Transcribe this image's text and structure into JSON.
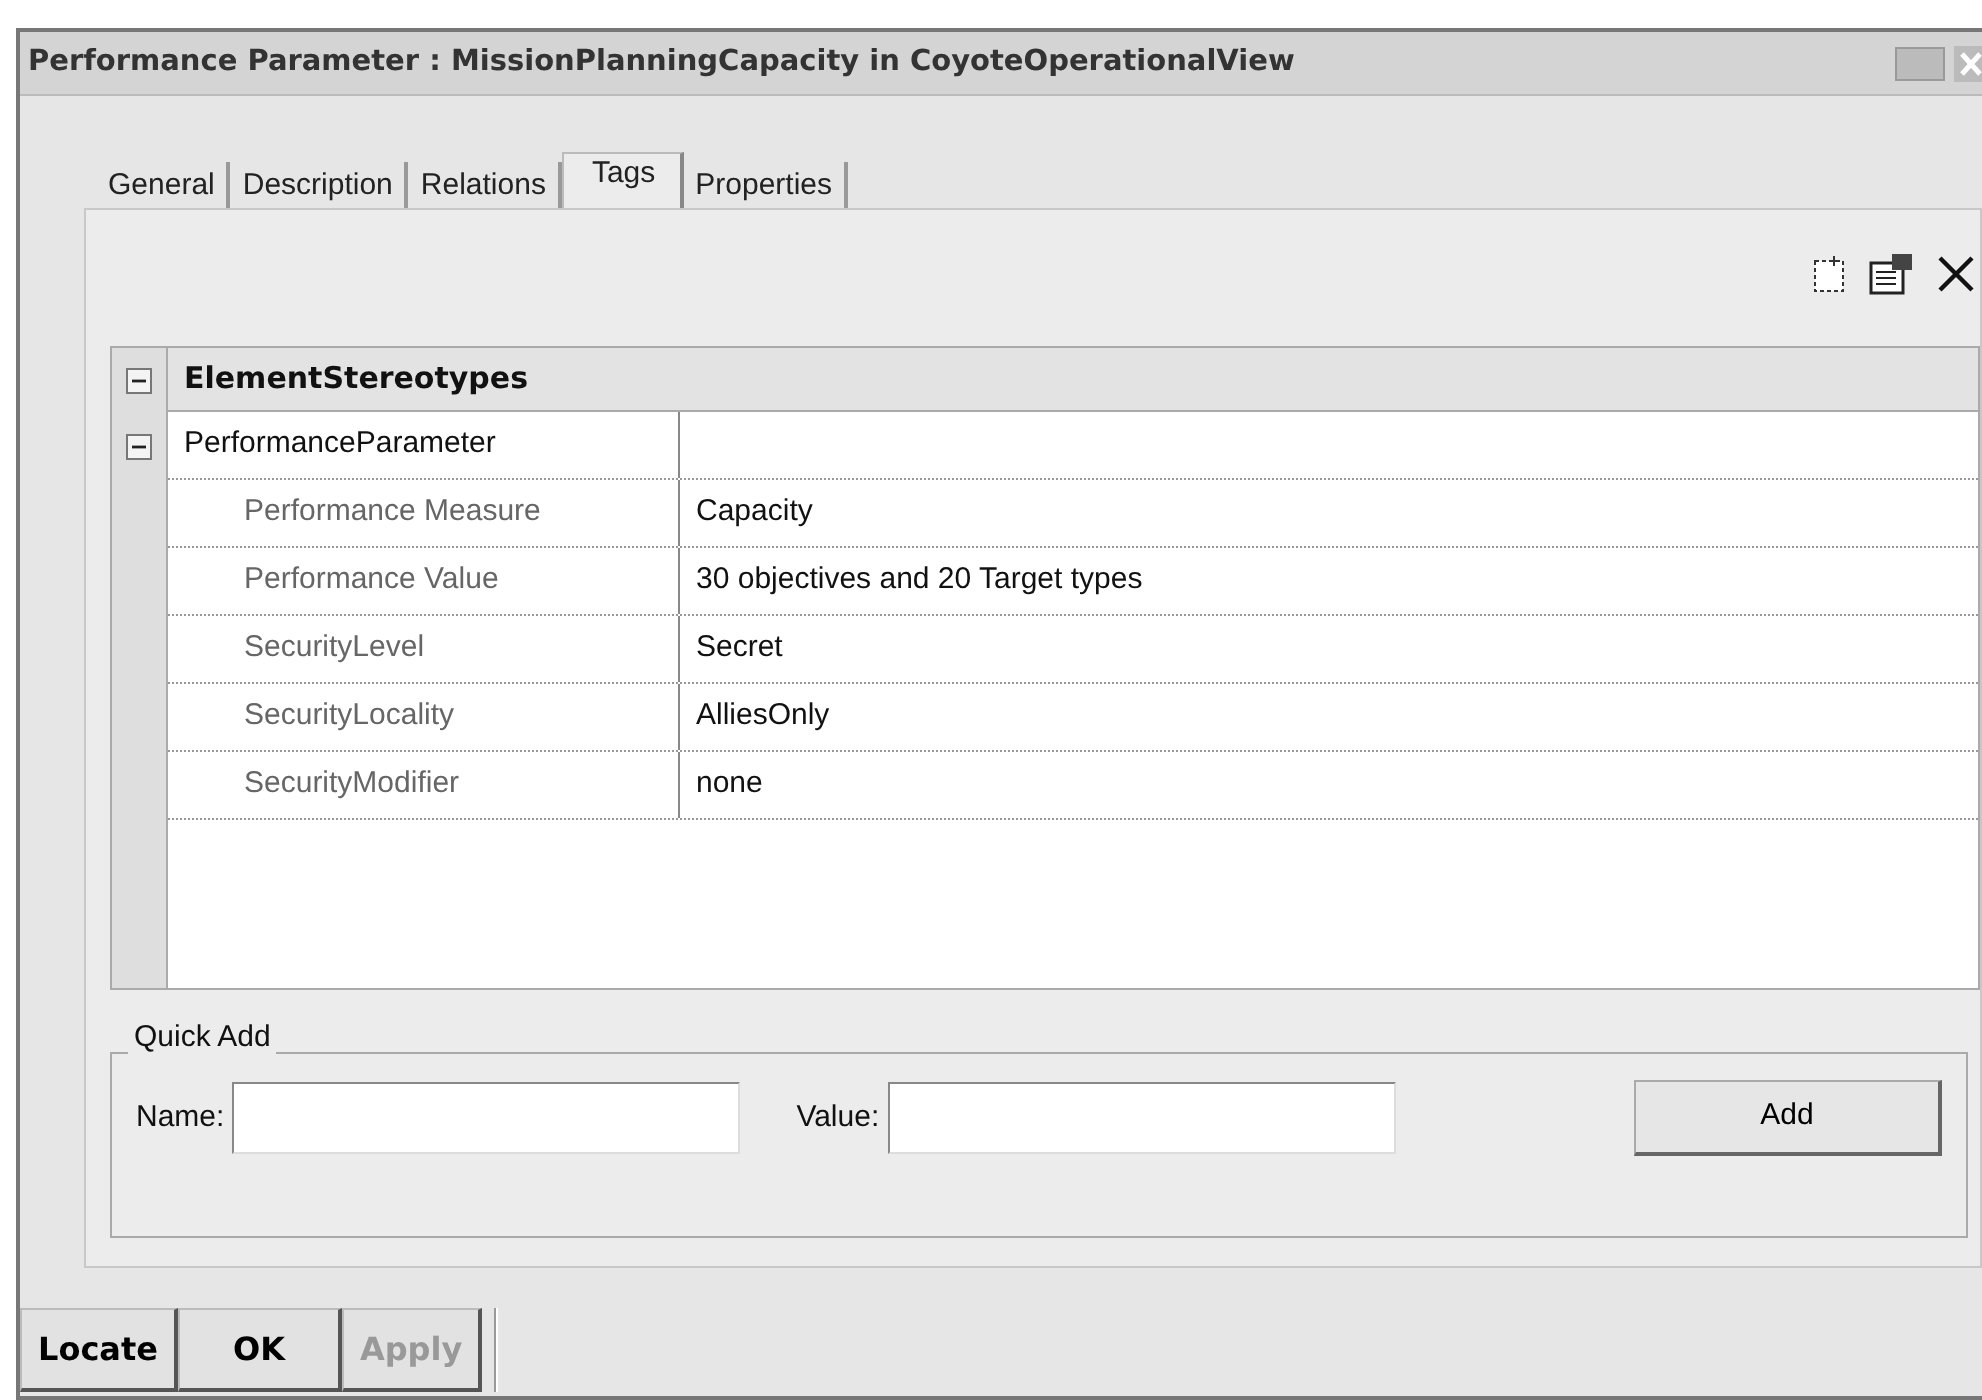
{
  "window": {
    "title": "Performance Parameter : MissionPlanningCapacity in CoyoteOperationalView"
  },
  "tabs": [
    {
      "label": "General",
      "selected": false
    },
    {
      "label": "Description",
      "selected": false
    },
    {
      "label": "Relations",
      "selected": false
    },
    {
      "label": "Tags",
      "selected": true
    },
    {
      "label": "Properties",
      "selected": false
    }
  ],
  "grid": {
    "category": {
      "label": "ElementStereotypes",
      "expanded": true
    },
    "group": {
      "label": "PerformanceParameter",
      "expanded": true
    },
    "rows": [
      {
        "name": "Performance Measure",
        "value": "Capacity"
      },
      {
        "name": "Performance Value",
        "value": "30 objectives and 20 Target types"
      },
      {
        "name": "SecurityLevel",
        "value": "Secret"
      },
      {
        "name": "SecurityLocality",
        "value": "AlliesOnly"
      },
      {
        "name": "SecurityModifier",
        "value": "none"
      }
    ]
  },
  "quick_add": {
    "legend": "Quick Add",
    "name_label": "Name:",
    "value_label": "Value:",
    "add_button": "Add"
  },
  "footer_buttons": [
    {
      "label": "Locate",
      "disabled": false
    },
    {
      "label": "OK",
      "disabled": false
    },
    {
      "label": "Apply",
      "disabled": true
    }
  ]
}
